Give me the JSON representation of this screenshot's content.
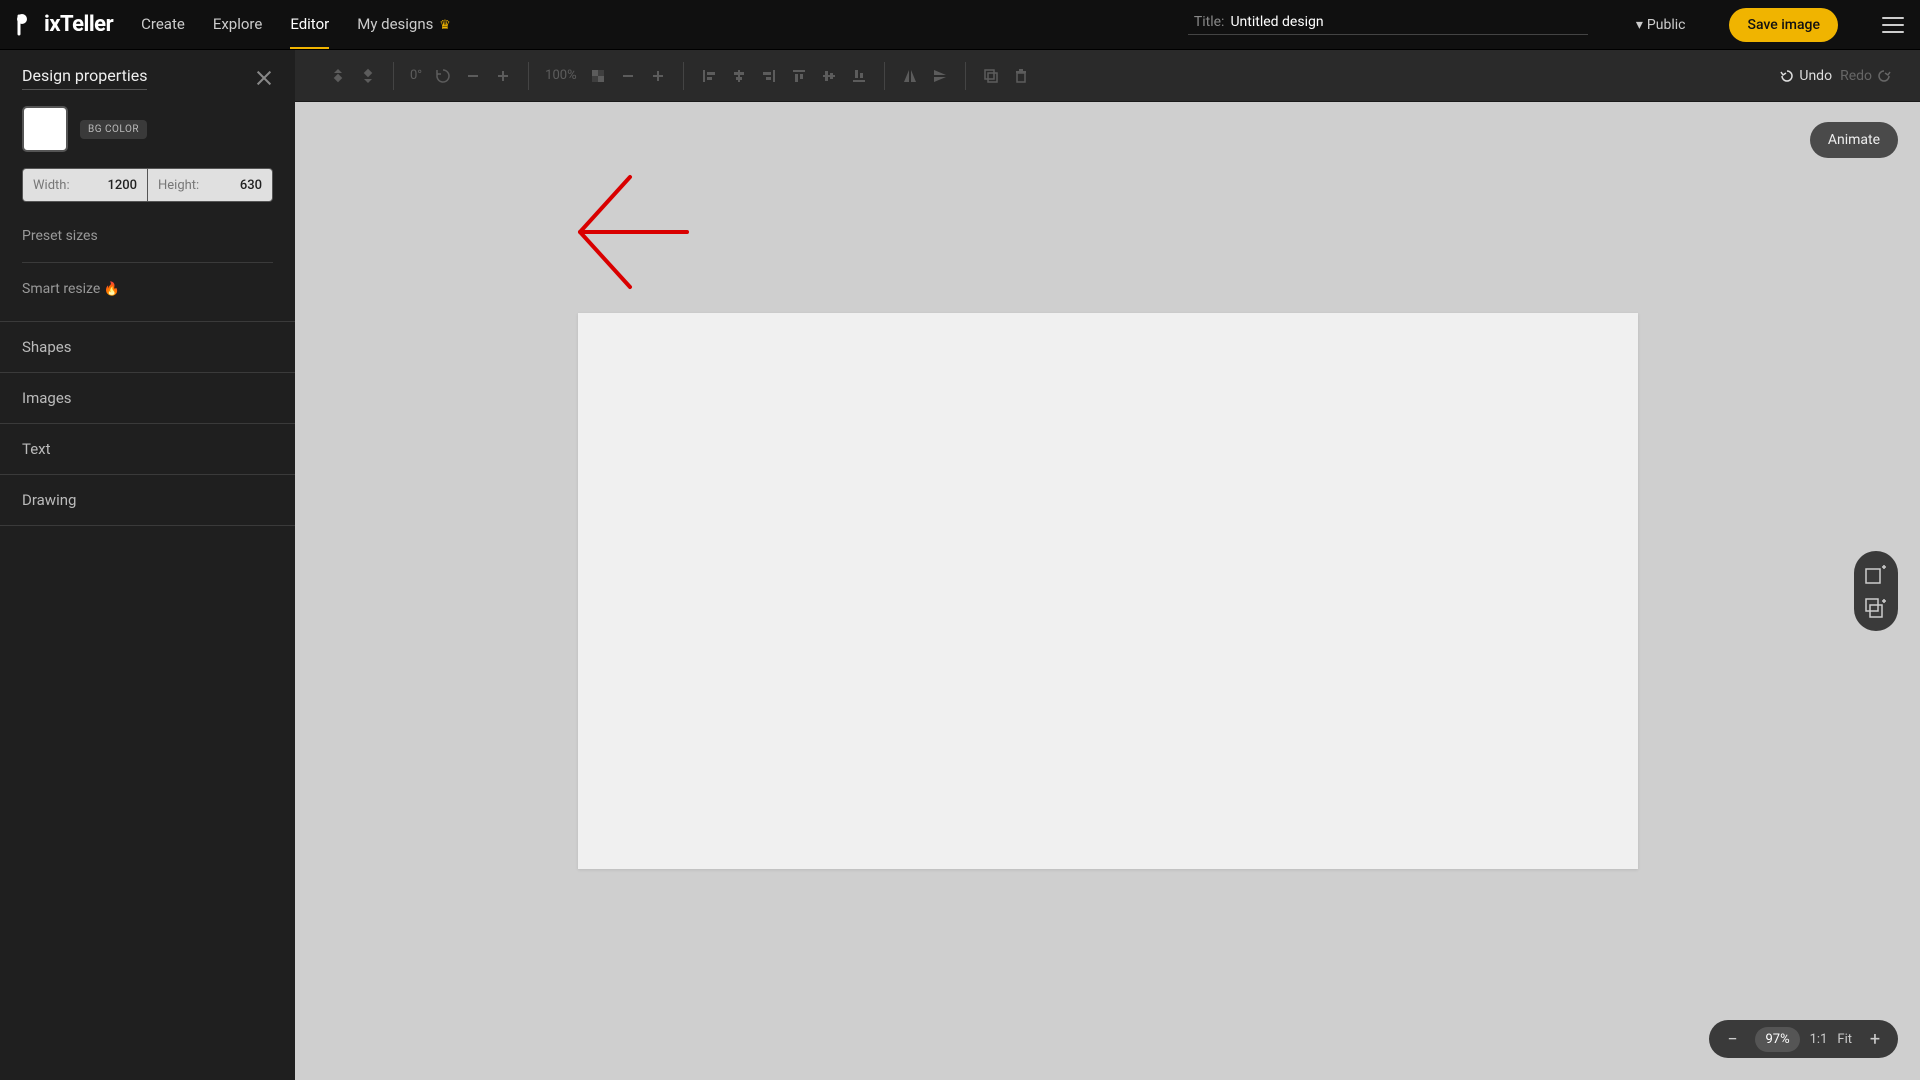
{
  "header": {
    "logo_text": "PixTeller",
    "nav": {
      "create": "Create",
      "explore": "Explore",
      "editor": "Editor",
      "my_designs": "My designs"
    },
    "title_label": "Title:",
    "title_value": "Untitled design",
    "visibility": "Public",
    "save_label": "Save image"
  },
  "sidebar": {
    "panel_title": "Design properties",
    "bg_color_label": "BG COLOR",
    "bg_color_hex": "#ffffff",
    "width_label": "Width:",
    "width_value": "1200",
    "height_label": "Height:",
    "height_value": "630",
    "preset_sizes": "Preset sizes",
    "smart_resize": "Smart resize",
    "sections": {
      "shapes": "Shapes",
      "images": "Images",
      "text": "Text",
      "drawing": "Drawing"
    }
  },
  "toolbar": {
    "rotation": "0°",
    "opacity": "100%",
    "undo": "Undo",
    "redo": "Redo"
  },
  "canvas": {
    "animate": "Animate"
  },
  "zoom": {
    "value": "97%",
    "one_one": "1:1",
    "fit": "Fit"
  },
  "colors": {
    "accent": "#f0b400",
    "annotation": "#d90000"
  }
}
